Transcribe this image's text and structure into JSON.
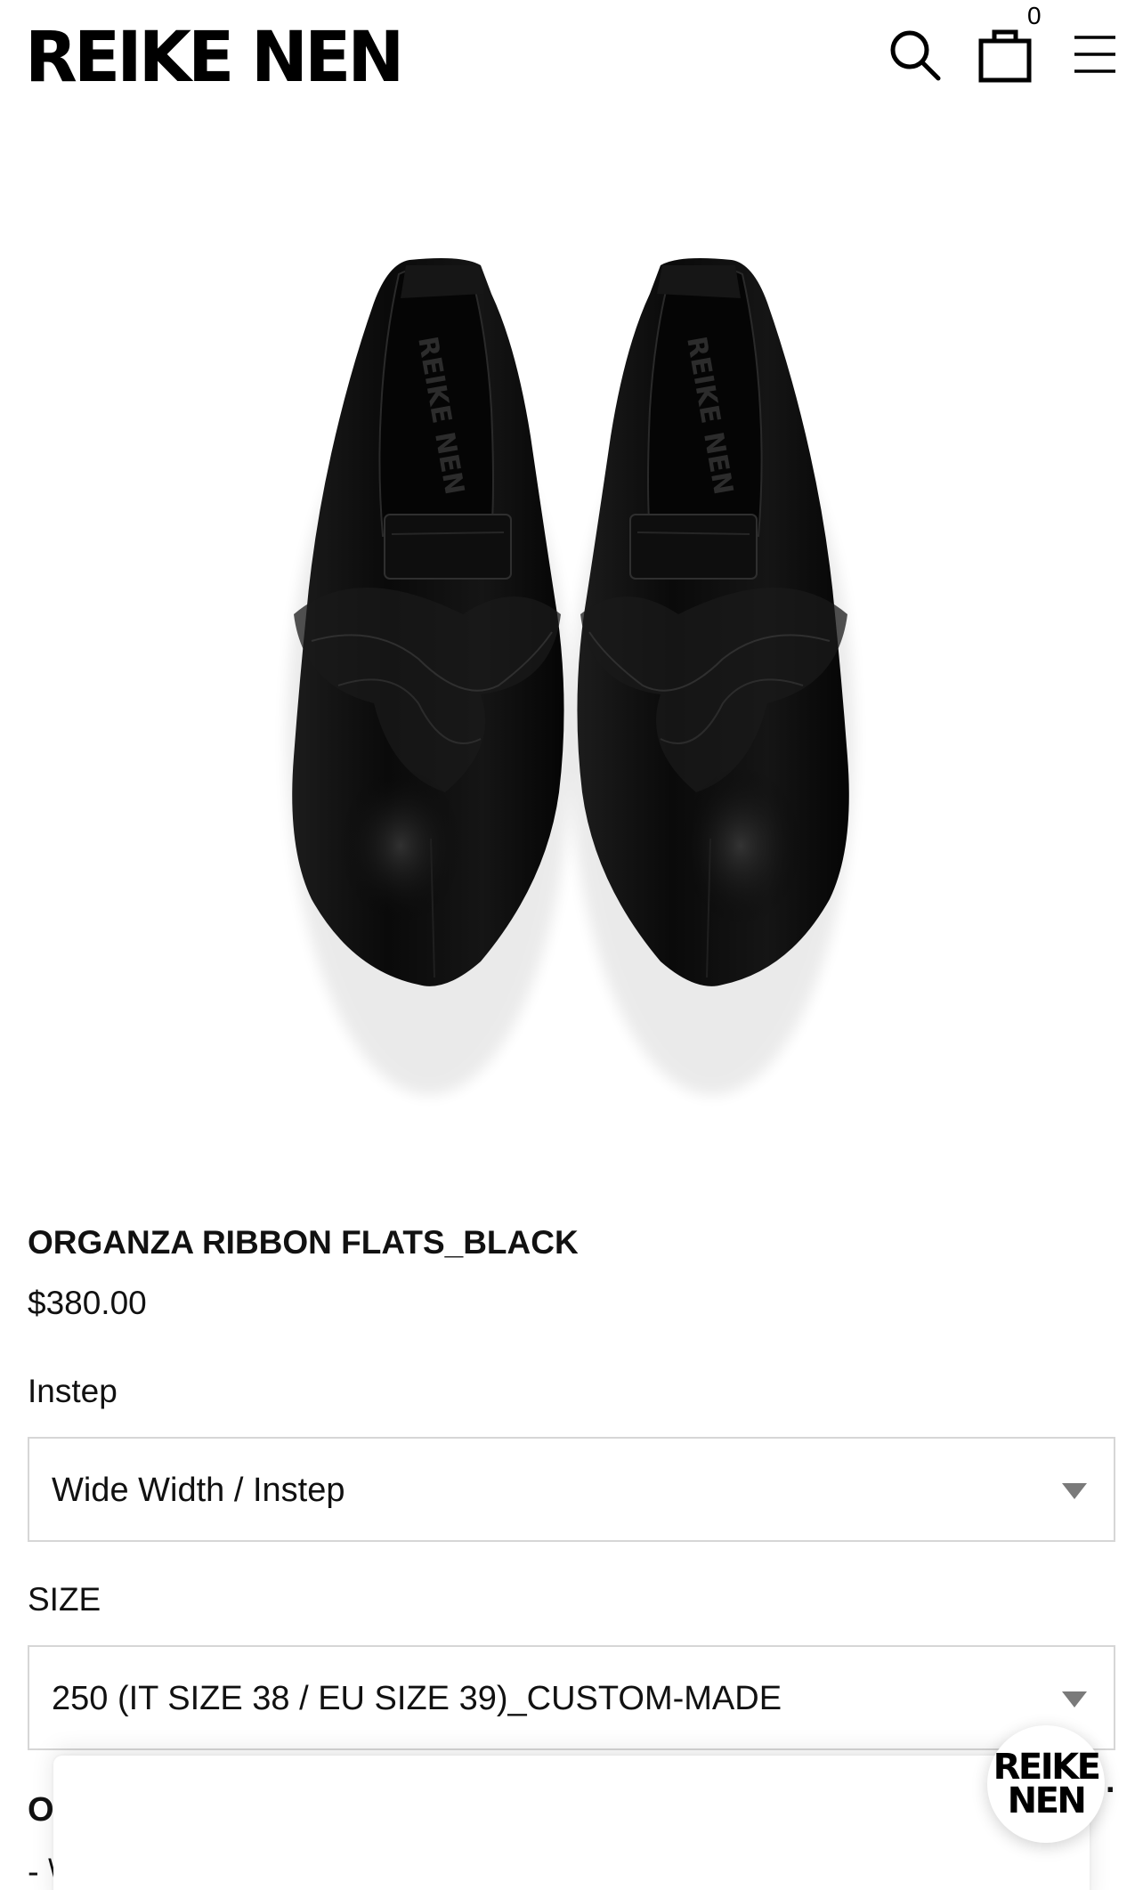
{
  "header": {
    "brand": "REIKE NEN",
    "cart_count": "0",
    "icons": {
      "search": "search-icon",
      "cart": "shopping-bag-icon",
      "menu": "hamburger-menu-icon"
    }
  },
  "product": {
    "image_alt": "product-photo",
    "insole_print": "REIKE NEN",
    "title": "ORGANZA RIBBON FLATS_BLACK",
    "price": "$380.00"
  },
  "options": {
    "instep": {
      "label": "Instep",
      "value": "Wide Width / Instep"
    },
    "size": {
      "label": "SIZE",
      "value": "250 (IT SIZE 38 / EU SIZE 39)_CUSTOM-MADE"
    }
  },
  "partial": {
    "heading_fragment": "O",
    "line_fragment": "- \\",
    "trailing_fragment": "."
  },
  "badge": {
    "line1": "REIKE",
    "line2": "NEN"
  },
  "colors": {
    "text": "#111111",
    "border": "#d6d6d6",
    "caret": "#7a7a7a",
    "shoe": "#0d0d0d"
  }
}
